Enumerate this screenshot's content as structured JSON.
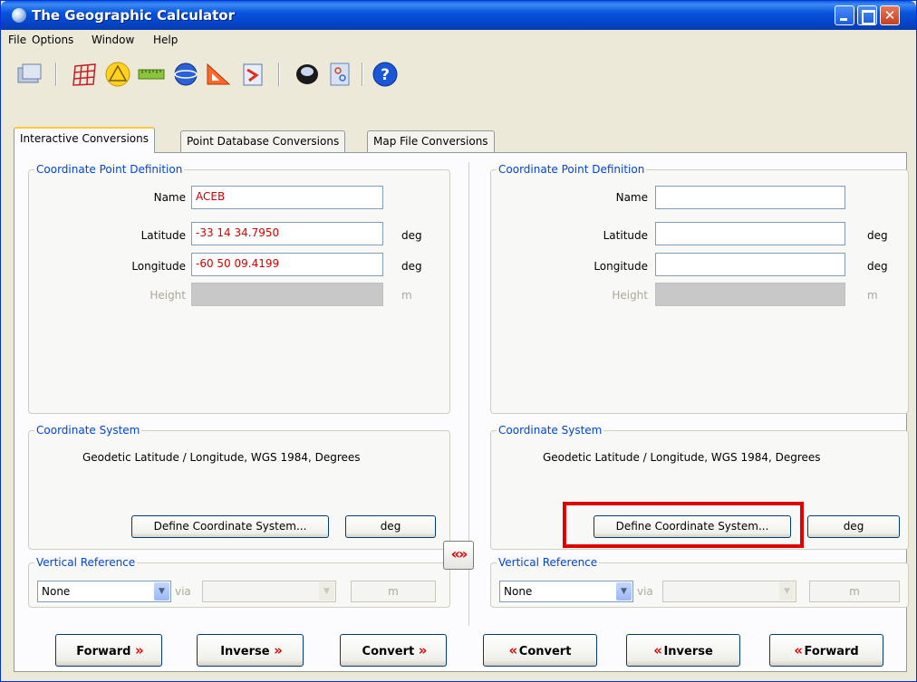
{
  "window": {
    "title": "The Geographic Calculator"
  },
  "menu": [
    {
      "label": "File",
      "key": "F"
    },
    {
      "label": "Options",
      "key": "O"
    },
    {
      "label": "Window",
      "key": "W"
    },
    {
      "label": "Help",
      "key": "H"
    }
  ],
  "toolbar": {
    "tools": [
      "open-window-icon",
      "grid-icon",
      "triangle-yellow-icon",
      "ruler-icon",
      "globe-icon",
      "triangle-red-icon",
      "arrow-document-icon",
      "blob-icon",
      "settings-document-icon",
      "help-icon"
    ]
  },
  "tabs": [
    {
      "label": "Interactive Conversions",
      "active": true
    },
    {
      "label": "Point Database Conversions",
      "active": false
    },
    {
      "label": "Map File Conversions",
      "active": false
    }
  ],
  "left": {
    "point_group_title": "Coordinate Point Definition",
    "name_label": "Name",
    "name_value": "ACEB",
    "lat_label": "Latitude",
    "lat_value": "-33 14 34.7950",
    "lat_unit": "deg",
    "lon_label": "Longitude",
    "lon_value": "-60 50 09.4199",
    "lon_unit": "deg",
    "height_label": "Height",
    "height_value": "",
    "height_unit": "m",
    "cs_group_title": "Coordinate System",
    "cs_text": "Geodetic Latitude / Longitude, WGS 1984, Degrees",
    "define_button": "Define Coordinate System...",
    "deg_button": "deg",
    "vr_group_title": "Vertical Reference",
    "vr_value": "None",
    "via_label": "via",
    "via_value": "",
    "vr_unit": "m"
  },
  "right": {
    "point_group_title": "Coordinate Point Definition",
    "name_label": "Name",
    "name_value": "",
    "lat_label": "Latitude",
    "lat_value": "",
    "lat_unit": "deg",
    "lon_label": "Longitude",
    "lon_value": "",
    "lon_unit": "deg",
    "height_label": "Height",
    "height_value": "",
    "height_unit": "m",
    "cs_group_title": "Coordinate System",
    "cs_text": "Geodetic Latitude / Longitude, WGS 1984, Degrees",
    "define_button": "Define Coordinate System...",
    "deg_button": "deg",
    "vr_group_title": "Vertical Reference",
    "vr_value": "None",
    "via_label": "via",
    "via_value": "",
    "vr_unit": "m"
  },
  "swap": {
    "glyph": "«»"
  },
  "bottom_buttons": [
    {
      "label": "Forward",
      "dir": "right"
    },
    {
      "label": "Inverse",
      "dir": "right"
    },
    {
      "label": "Convert",
      "dir": "right"
    },
    {
      "label": "Convert",
      "dir": "left"
    },
    {
      "label": "Inverse",
      "dir": "left"
    },
    {
      "label": "Forward",
      "dir": "left"
    }
  ],
  "colors": {
    "accent": "#0046d5",
    "value_text": "#d00000",
    "highlight": "#e00000",
    "titlebar": "#0855dd"
  }
}
